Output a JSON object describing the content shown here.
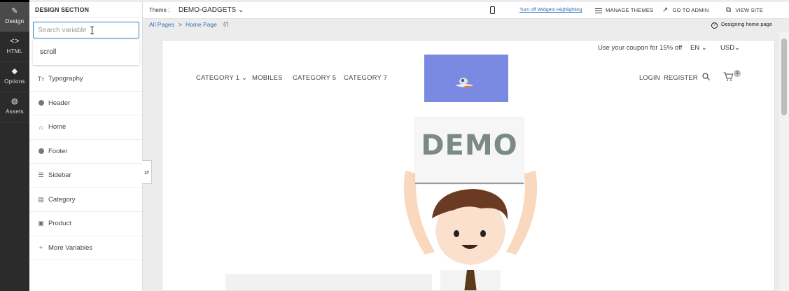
{
  "rail": {
    "items": [
      {
        "label": "Design",
        "icon": "brush-icon",
        "glyph": "✎"
      },
      {
        "label": "HTML",
        "icon": "code-icon",
        "glyph": "<>"
      },
      {
        "label": "Options",
        "icon": "bucket-icon",
        "glyph": "◆"
      },
      {
        "label": "Assets",
        "icon": "palette-icon",
        "glyph": "◍"
      }
    ]
  },
  "panel": {
    "title": "DESIGN SECTION",
    "search_placeholder": "Search variable",
    "suggestion": "scroll",
    "menu": [
      {
        "label": "Typography",
        "icon": "typography-icon",
        "glyph": "Tт"
      },
      {
        "label": "Header",
        "icon": "dot-icon",
        "glyph": ""
      },
      {
        "label": "Home",
        "icon": "home-icon",
        "glyph": "⌂"
      },
      {
        "label": "Footer",
        "icon": "dot-icon",
        "glyph": ""
      },
      {
        "label": "Sidebar",
        "icon": "list-icon",
        "glyph": "☰"
      },
      {
        "label": "Category",
        "icon": "category-icon",
        "glyph": "▤"
      },
      {
        "label": "Product",
        "icon": "product-icon",
        "glyph": "▣"
      },
      {
        "label": "More Variables",
        "icon": "plus-icon",
        "glyph": "+"
      }
    ]
  },
  "topbar": {
    "theme_label": "Theme :",
    "theme_value": "DEMO-GADGETS ⌄",
    "highlight_toggle": "Turn off Widgets Highlighting",
    "manage_themes": "MANAGE THEMES",
    "go_to_admin": "GO TO ADMIN",
    "view_site": "VIEW SITE"
  },
  "breadcrumb": {
    "items": [
      "All Pages",
      "Home Page"
    ],
    "separator": ">",
    "path": "(/)",
    "status": "Designing home page"
  },
  "preview": {
    "coupon": "Use your coupon for 15% off",
    "language": "EN ⌄",
    "currency": "USD⌄",
    "nav": [
      "CATEGORY 1 ⌄",
      "MOBILES",
      "CATEGORY 5",
      "CATEGORY 7"
    ],
    "login": "LOGIN",
    "register": "REGISTER",
    "cart_count": "1",
    "hero_text": "DEMO"
  }
}
